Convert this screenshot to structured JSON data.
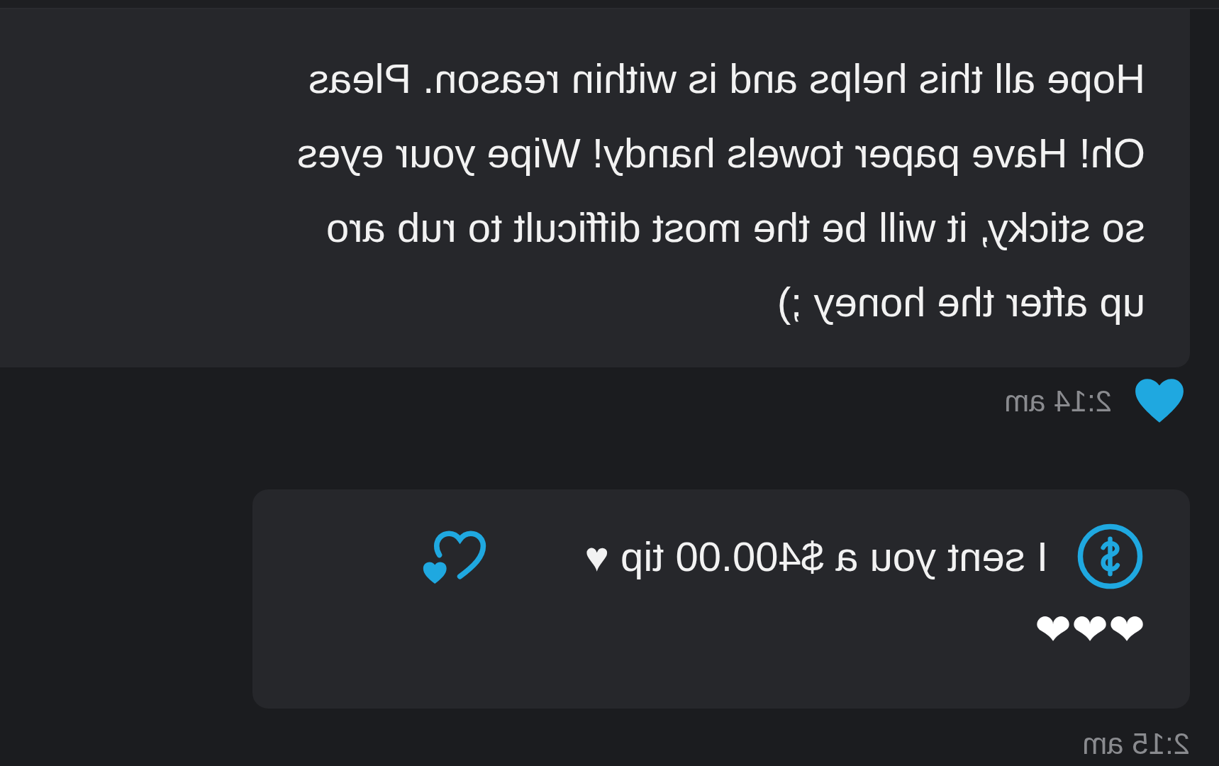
{
  "messages": [
    {
      "kind": "text",
      "lines": [
        "Hope all this helps and is within reason. Pleas",
        "Oh! Have paper towels handy! Wipe your eyes",
        "so sticky, it will be the most difficult to rub aro",
        "up after the honey ;)"
      ],
      "liked": true,
      "time": "2:14 am"
    },
    {
      "kind": "tip",
      "text": "I sent you a $400.00 tip ♥",
      "extra": "❤❤❤",
      "time": "2:15 am"
    }
  ]
}
